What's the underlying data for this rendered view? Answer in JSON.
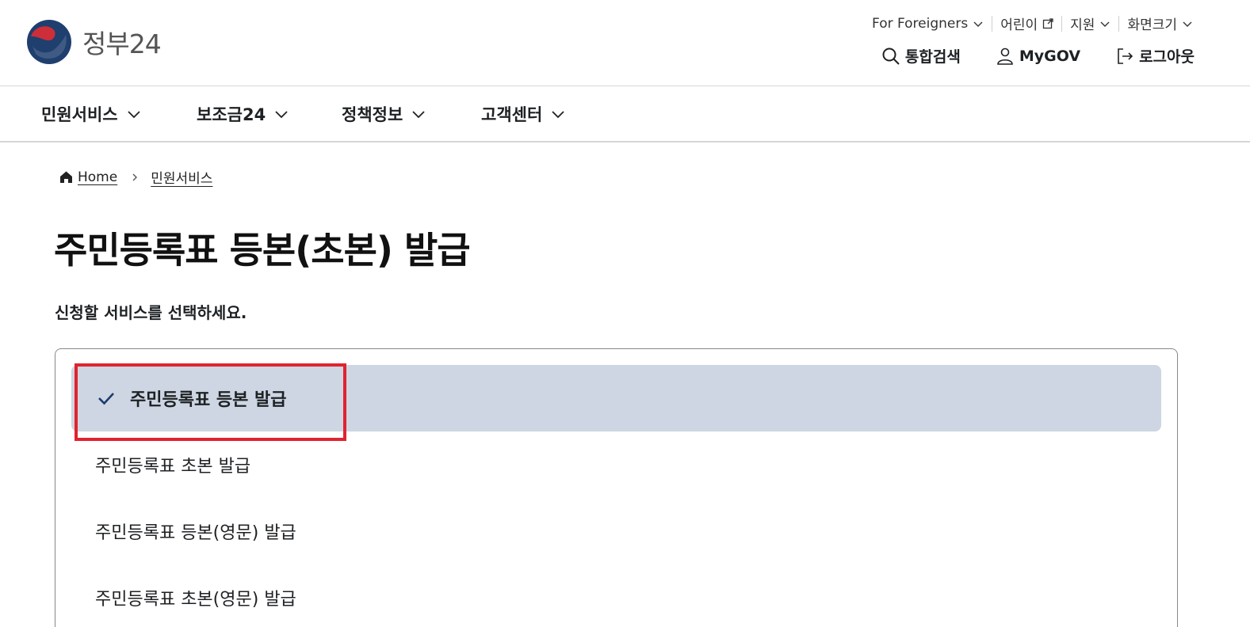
{
  "brand": {
    "name": "정부24"
  },
  "utility": [
    {
      "label": "For Foreigners",
      "icon": "chevron-down-icon"
    },
    {
      "label": "어린이",
      "icon": "external-link-icon"
    },
    {
      "label": "지원",
      "icon": "chevron-down-icon"
    },
    {
      "label": "화면크기",
      "icon": "chevron-down-icon"
    }
  ],
  "actions": {
    "search": "통합검색",
    "mygov": "MyGOV",
    "logout": "로그아웃"
  },
  "nav": [
    {
      "label": "민원서비스"
    },
    {
      "label": "보조금24"
    },
    {
      "label": "정책정보"
    },
    {
      "label": "고객센터"
    }
  ],
  "breadcrumb": {
    "home": "Home",
    "current": "민원서비스"
  },
  "page": {
    "title": "주민등록표 등본(초본) 발급",
    "subtitle": "신청할 서비스를 선택하세요."
  },
  "options": [
    {
      "label": "주민등록표 등본 발급",
      "selected": true
    },
    {
      "label": "주민등록표 초본 발급",
      "selected": false
    },
    {
      "label": "주민등록표 등본(영문) 발급",
      "selected": false
    },
    {
      "label": "주민등록표 초본(영문) 발급",
      "selected": false
    }
  ],
  "colors": {
    "selected_bg": "#cdd6e2",
    "highlight": "#e0232f",
    "check": "#1d3a6e"
  }
}
